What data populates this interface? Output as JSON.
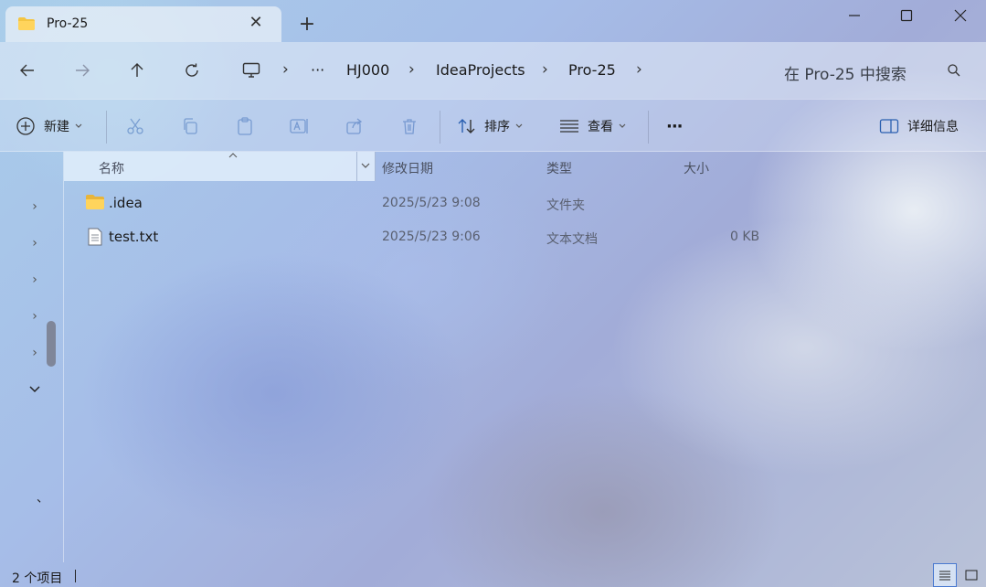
{
  "window": {
    "tab_title": "Pro-25",
    "tab_close_glyph": "✕",
    "new_tab_glyph": "+"
  },
  "address": {
    "crumbs": [
      "···",
      "HJ000",
      "IdeaProjects",
      "Pro-25"
    ],
    "search_placeholder": "在 Pro-25 中搜索"
  },
  "toolbar": {
    "new_label": "新建",
    "sort_label": "排序",
    "view_label": "查看",
    "more_label": "···",
    "details_label": "详细信息"
  },
  "columns": {
    "name": "名称",
    "modified": "修改日期",
    "type": "类型",
    "size": "大小"
  },
  "files": [
    {
      "name": ".idea",
      "modified": "2025/5/23 9:08",
      "type": "文件夹",
      "size": "",
      "icon": "folder-icon"
    },
    {
      "name": "test.txt",
      "modified": "2025/5/23 9:06",
      "type": "文本文档",
      "size": "0 KB",
      "icon": "text-file-icon"
    }
  ],
  "sidebar": {
    "stray_mark": "、"
  },
  "status": {
    "item_count": "2 个项目"
  },
  "colors": {
    "folder": "#f4c542",
    "accent": "#2a6fd0"
  }
}
